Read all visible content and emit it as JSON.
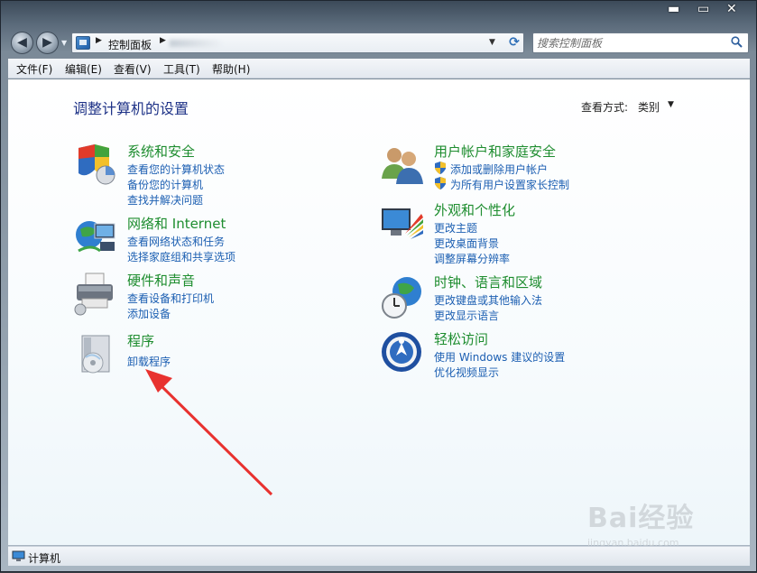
{
  "window": {
    "buttons": {
      "minimize": "▬",
      "maximize": "▭",
      "close": "✕"
    }
  },
  "nav": {
    "back_icon": "arrow-left-icon",
    "forward_icon": "arrow-right-icon",
    "address": {
      "path": "控制面板",
      "separator": "▶"
    },
    "search": {
      "placeholder": "搜索控制面板"
    }
  },
  "menu": [
    {
      "label": "文件(F)"
    },
    {
      "label": "编辑(E)"
    },
    {
      "label": "查看(V)"
    },
    {
      "label": "工具(T)"
    },
    {
      "label": "帮助(H)"
    }
  ],
  "main": {
    "title": "调整计算机的设置",
    "view_by_label": "查看方式:",
    "view_by_value": "类别",
    "view_by_arrow": "▼",
    "categories": [
      {
        "title": "系统和安全",
        "icon": "shield-chart-icon",
        "links": [
          "查看您的计算机状态",
          "备份您的计算机",
          "查找并解决问题"
        ]
      },
      {
        "title": "网络和 Internet",
        "icon": "globe-network-icon",
        "links": [
          "查看网络状态和任务",
          "选择家庭组和共享选项"
        ]
      },
      {
        "title": "硬件和声音",
        "icon": "printer-icon",
        "links": [
          "查看设备和打印机",
          "添加设备"
        ]
      },
      {
        "title": "程序",
        "icon": "program-disc-icon",
        "links": [
          "卸载程序"
        ]
      },
      {
        "title": "用户帐户和家庭安全",
        "icon": "users-icon",
        "links": [
          "添加或删除用户帐户",
          "为所有用户设置家长控制"
        ]
      },
      {
        "title": "外观和个性化",
        "icon": "monitor-color-icon",
        "links": [
          "更改主题",
          "更改桌面背景",
          "调整屏幕分辨率"
        ]
      },
      {
        "title": "时钟、语言和区域",
        "icon": "clock-globe-icon",
        "links": [
          "更改键盘或其他输入法",
          "更改显示语言"
        ]
      },
      {
        "title": "轻松访问",
        "icon": "accessibility-icon",
        "links": [
          "使用 Windows 建议的设置",
          "优化视频显示"
        ]
      }
    ]
  },
  "watermark": {
    "brand": "Bai经验",
    "url": "jingyan.baidu.com"
  },
  "status": {
    "text": "计算机"
  },
  "colors": {
    "title_blue": "#1e3287",
    "category_green": "#1e8d2f",
    "link_blue": "#1c5fb2",
    "arrow_red": "#e8322f"
  }
}
